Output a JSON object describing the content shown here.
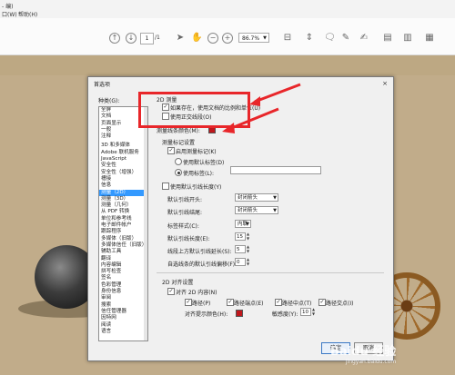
{
  "menubar": {
    "title": "- 编)",
    "menus": [
      "口(W)",
      "帮助(H)"
    ],
    "doc_tab": "df"
  },
  "toolbar": {
    "page_current": "1",
    "page_total": "/1",
    "zoom_value": "86.7%",
    "icons": [
      "arrow-up-icon",
      "arrow-down-icon",
      "cursor-icon",
      "hand-icon",
      "zoom-out-icon",
      "zoom-in-icon",
      "fit-page-icon",
      "scroll-icon",
      "comment-icon",
      "pen-icon",
      "sign-icon",
      "stamp-icon",
      "export-icon",
      "share-icon"
    ]
  },
  "dialog": {
    "title": "首选项",
    "close": "×",
    "category_label": "种类(G):",
    "categories_top": [
      "全屏",
      "文档",
      "页面显示",
      "一般",
      "注释"
    ],
    "categories": [
      "3D 和多媒体",
      "Adobe 联机服务",
      "JavaScript",
      "安全性",
      "安全性（增强）",
      "槽接",
      "信息",
      "测量（2D）",
      "测量（3D）",
      "测量（几何）",
      "从 PDF 转换",
      "单位和参考线",
      "电子邮件帐户",
      "跟踪程序",
      "多媒体（旧版）",
      "多媒体信任（旧版）",
      "辅助工具",
      "翻译",
      "内容编辑",
      "拼写检查",
      "签名",
      "色彩管理",
      "身份信息",
      "审阅",
      "搜索",
      "信任管理器",
      "因特网",
      "阅读",
      "语言"
    ],
    "selected_category": "测量（2D）",
    "section_2d": "2D 测量",
    "chk_scale_label": "如果存在，使用文档的比例和单位(U)",
    "chk_scale_checked": true,
    "chk_snap_label": "使用正交线段(O)",
    "chk_snap_checked": false,
    "line_color_label": "测量线条颜色(M):",
    "line_color": "#c0171c",
    "markup_section": "测量标记设置",
    "chk_markup_label": "启用测量标记(K)",
    "chk_markup_checked": true,
    "radio_default_label": "使用默认标签(D)",
    "radio_custom_label": "使用标签(L):",
    "custom_label_value": "",
    "chk_default_style_label": "使用默认引线长度(Y)",
    "chk_default_style_checked": false,
    "line_start_label": "默认引线开头:",
    "line_start_value": "封闭箭头",
    "line_end_label": "默认引线结尾:",
    "line_end_value": "封闭箭头",
    "label_style_label": "标签样式(C):",
    "label_style_value": "内联",
    "leader_len_label": "默认引线长度(E):",
    "leader_len_value": "15",
    "leader_ext_label": "线段上方默认引线延长(S):",
    "leader_ext_value": "5",
    "leader_offset_label": "自选线条的默认引线偏移(F):",
    "leader_offset_value": "0",
    "snap_section": "2D 对齐设置",
    "chk_snap2d_label": "对齐 2D 内容(N)",
    "chk_snap2d_checked": true,
    "snap_opts": [
      "路径(P)",
      "路径端点(E)",
      "路径中点(T)",
      "路径交点(I)"
    ],
    "snap_color_label": "对齐提示颜色(H):",
    "snap_color": "#c0171c",
    "sensitivity_label": "敏感度(Y):",
    "sensitivity_value": "10",
    "ok_label": "确定",
    "cancel_label": "取消"
  },
  "annotations": {
    "highlight_color": "#e8262a"
  },
  "watermark": {
    "text": "Baidu 经验",
    "sub": "jingyan.baidu.com"
  }
}
